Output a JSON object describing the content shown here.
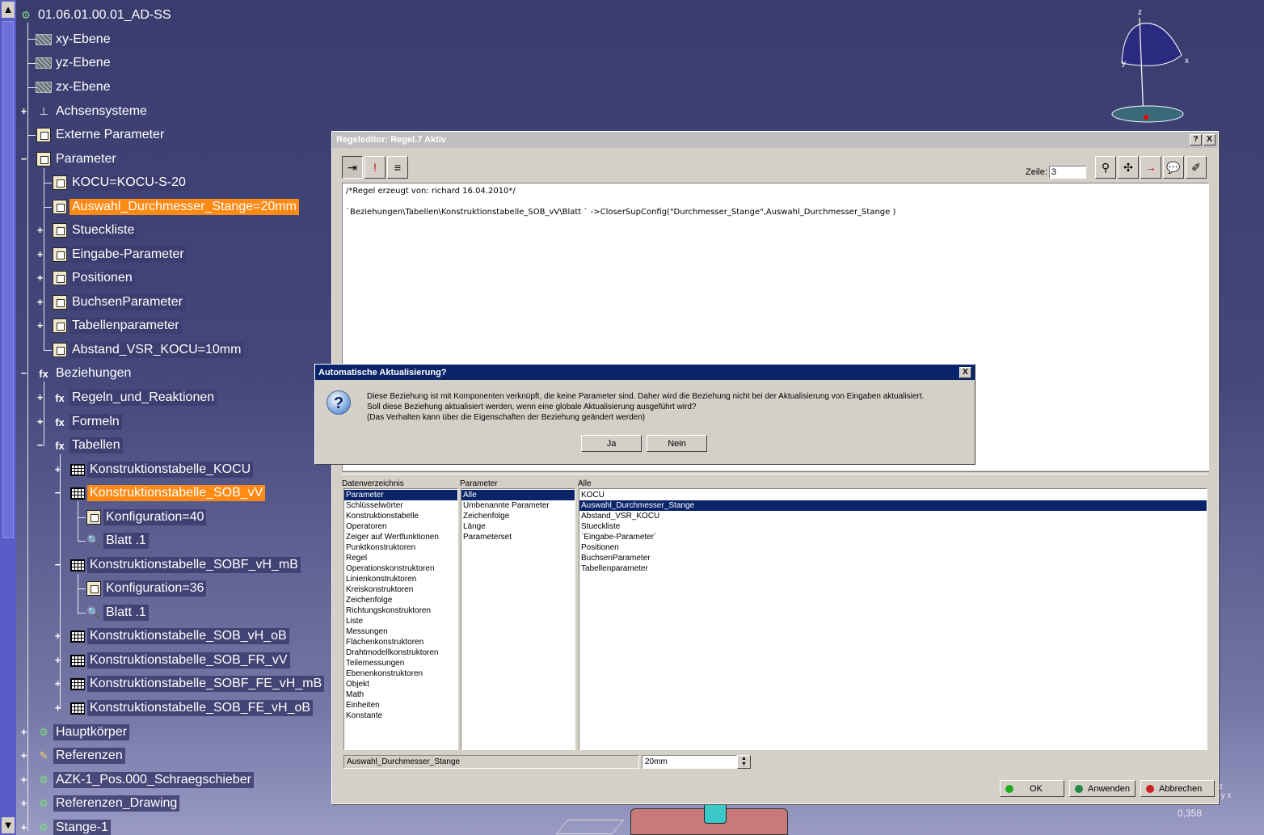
{
  "tree": {
    "root": "01.06.01.00.01_AD-SS",
    "nodes": [
      {
        "label": "xy-Ebene"
      },
      {
        "label": "yz-Ebene"
      },
      {
        "label": "zx-Ebene"
      },
      {
        "label": "Achsensysteme"
      },
      {
        "label": "Externe Parameter"
      },
      {
        "label": "Parameter"
      },
      {
        "label": "KOCU=KOCU-S-20"
      },
      {
        "label": "Auswahl_Durchmesser_Stange=20mm"
      },
      {
        "label": "Stueckliste"
      },
      {
        "label": "Eingabe-Parameter"
      },
      {
        "label": "Positionen"
      },
      {
        "label": "BuchsenParameter"
      },
      {
        "label": "Tabellenparameter"
      },
      {
        "label": "Abstand_VSR_KOCU=10mm"
      },
      {
        "label": "Beziehungen"
      },
      {
        "label": "Regeln_und_Reaktionen"
      },
      {
        "label": "Formeln"
      },
      {
        "label": "Tabellen"
      },
      {
        "label": "Konstruktionstabelle_KOCU"
      },
      {
        "label": "Konstruktionstabelle_SOB_vV"
      },
      {
        "label": "Konfiguration=40"
      },
      {
        "label": "Blatt .1"
      },
      {
        "label": "Konstruktionstabelle_SOBF_vH_mB"
      },
      {
        "label": "Konfiguration=36"
      },
      {
        "label": "Blatt .1"
      },
      {
        "label": "Konstruktionstabelle_SOB_vH_oB"
      },
      {
        "label": "Konstruktionstabelle_SOB_FR_vV"
      },
      {
        "label": "Konstruktionstabelle_SOBF_FE_vH_mB"
      },
      {
        "label": "Konstruktionstabelle_SOB_FE_vH_oB"
      },
      {
        "label": "Hauptkörper"
      },
      {
        "label": "Referenzen"
      },
      {
        "label": "AZK-1_Pos.000_Schraegschieber"
      },
      {
        "label": "Referenzen_Drawing"
      },
      {
        "label": "Stange-1"
      }
    ]
  },
  "compass": {
    "z": "z",
    "y": "y",
    "x": "x"
  },
  "editor": {
    "title": "Regeleditor: Regel.7 Aktiv",
    "help_btn": "?",
    "close_btn": "X",
    "zeile_label": "Zeile:",
    "zeile_value": "3",
    "code_lines": [
      "/*Regel erzeugt von: richard 16.04.2010*/",
      "",
      "`Beziehungen\\Tabellen\\Konstruktionstabelle_SOB_vV\\Blatt ` ->CloserSupConfig(\"Durchmesser_Stange\",Auswahl_Durchmesser_Stange )"
    ],
    "col_headers": {
      "dict": "Datenverzeichnis",
      "param": "Parameter",
      "all": "Alle"
    },
    "dict_items": [
      "Parameter",
      "Schlüsselwörter",
      "Konstruktionstabelle",
      "Operatoren",
      "Zeiger auf Wertfunktionen",
      "Punktkonstruktoren",
      "Regel",
      "Operationskonstruktoren",
      "Linienkonstruktoren",
      "Kreiskonstruktoren",
      "Zeichenfolge",
      "Richtungskonstruktoren",
      "Liste",
      "Messungen",
      "Flächenkonstruktoren",
      "Drahtmodellkonstruktoren",
      "Teilemessungen",
      "Ebenenkonstruktoren",
      "Objekt",
      "Math",
      "Einheiten",
      "Konstante"
    ],
    "param_items": [
      "Alle",
      "Umbenannte Parameter",
      "Zeichenfolge",
      "Länge",
      "Parameterset"
    ],
    "all_items": [
      "KOCU",
      "Auswahl_Durchmesser_Stange",
      "Abstand_VSR_KOCU",
      "Stueckliste",
      "`Eingabe-Parameter`",
      "Positionen",
      "BuchsenParameter",
      "Tabellenparameter"
    ],
    "selected_name": "Auswahl_Durchmesser_Stange",
    "selected_value": "20mm",
    "ok_label": "OK",
    "apply_label": "Anwenden",
    "cancel_label": "Abbrechen"
  },
  "dialog": {
    "title": "Automatische Aktualisierung?",
    "close_btn": "X",
    "icon": "?",
    "lines": [
      "Diese Beziehung ist mit Komponenten verknüpft, die keine Parameter sind. Daher wird die Beziehung nicht bei der Aktualisierung von Eingaben aktualisiert.",
      "Soll diese Beziehung aktualisiert werden, wenn eine globale Aktualisierung ausgeführt wird?",
      "(Das Verhalten kann über die Eigenschaften der Beziehung geändert werden)"
    ],
    "yes_label": "Ja",
    "no_label": "Nein"
  },
  "status": {
    "coord": "0,358"
  },
  "colors": {
    "accent_selected": "#ff8a14",
    "list_selection": "#0a246a",
    "background": "#3a3c6e"
  }
}
